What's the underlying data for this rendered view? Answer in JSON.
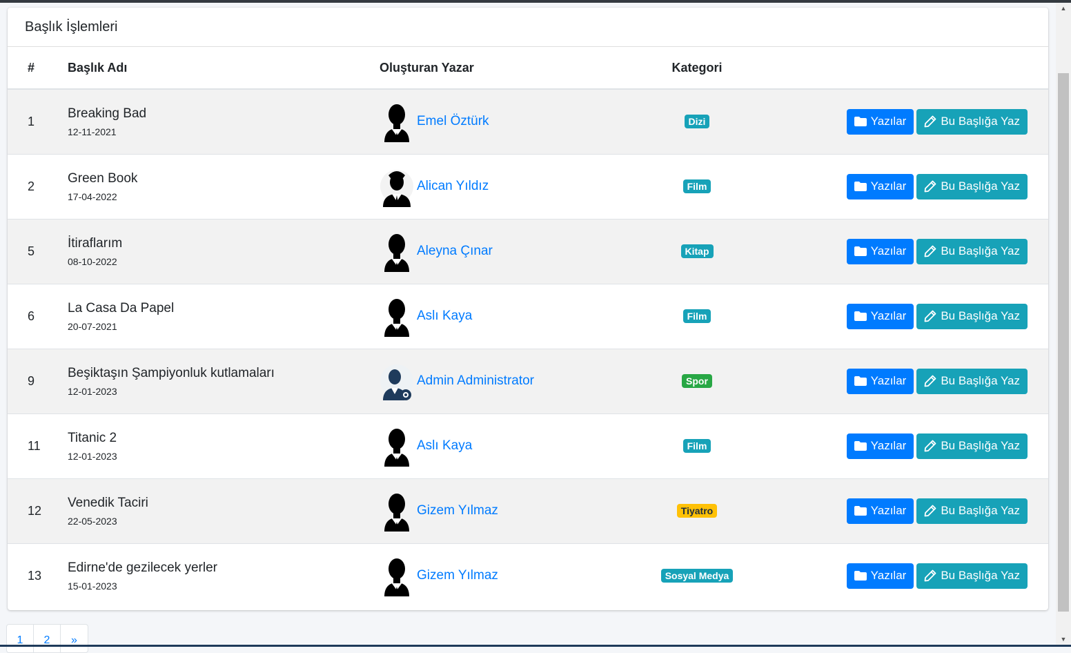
{
  "card": {
    "title": "Başlık İşlemleri"
  },
  "table": {
    "headers": {
      "num": "#",
      "title": "Başlık Adı",
      "author": "Oluşturan Yazar",
      "category": "Kategori"
    },
    "rows": [
      {
        "num": "1",
        "title": "Breaking Bad",
        "date": "12-11-2021",
        "author": "Emel Öztürk",
        "avatar": "user-silhouette-icon",
        "category": "Dizi",
        "badge_color": "#17a2b8"
      },
      {
        "num": "2",
        "title": "Green Book",
        "date": "17-04-2022",
        "author": "Alican Yıldız",
        "avatar": "businessman-icon",
        "category": "Film",
        "badge_color": "#17a2b8"
      },
      {
        "num": "5",
        "title": "İtiraflarım",
        "date": "08-10-2022",
        "author": "Aleyna Çınar",
        "avatar": "user-silhouette-icon",
        "category": "Kitap",
        "badge_color": "#17a2b8"
      },
      {
        "num": "6",
        "title": "La Casa Da Papel",
        "date": "20-07-2021",
        "author": "Aslı Kaya",
        "avatar": "user-silhouette-icon",
        "category": "Film",
        "badge_color": "#17a2b8"
      },
      {
        "num": "9",
        "title": "Beşiktaşın Şampiyonluk kutlamaları",
        "date": "12-01-2023",
        "author": "Admin Administrator",
        "avatar": "admin-user-gear-icon",
        "category": "Spor",
        "badge_color": "#28a745"
      },
      {
        "num": "11",
        "title": "Titanic 2",
        "date": "12-01-2023",
        "author": "Aslı Kaya",
        "avatar": "user-silhouette-icon",
        "category": "Film",
        "badge_color": "#17a2b8"
      },
      {
        "num": "12",
        "title": "Venedik Taciri",
        "date": "22-05-2023",
        "author": "Gizem Yılmaz",
        "avatar": "user-silhouette-icon",
        "category": "Tiyatro",
        "badge_color": "#ffc107"
      },
      {
        "num": "13",
        "title": "Edirne'de gezilecek yerler",
        "date": "15-01-2023",
        "author": "Gizem Yılmaz",
        "avatar": "user-silhouette-icon",
        "category": "Sosyal Medya",
        "badge_color": "#17a2b8"
      }
    ]
  },
  "actions": {
    "posts_label": "Yazılar",
    "posts_icon": "folder-icon",
    "write_label": "Bu Başlığa Yaz",
    "write_icon": "pencil-icon"
  },
  "pagination": {
    "pages": [
      "1",
      "2",
      "»"
    ]
  },
  "colors": {
    "primary": "#007bff",
    "info": "#17a2b8",
    "success": "#28a745",
    "warning": "#ffc107"
  }
}
